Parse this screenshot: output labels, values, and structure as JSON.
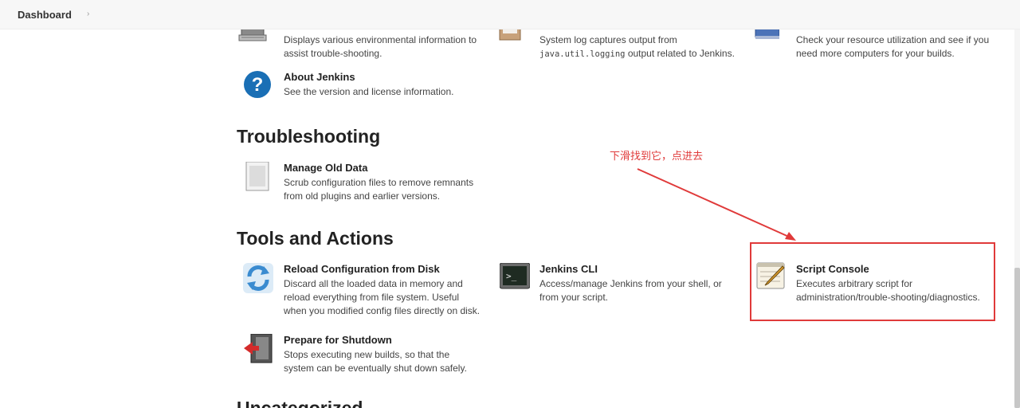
{
  "header": {
    "breadcrumb": "Dashboard",
    "separator": "›"
  },
  "items": {
    "system_info_desc": "Displays various environmental information to assist trouble-shooting.",
    "system_log_desc_a": "System log captures output from",
    "system_log_desc_code": "java.util.logging",
    "system_log_desc_b": "output related to Jenkins.",
    "load_stats_desc": "Check your resource utilization and see if you need more computers for your builds.",
    "about_title": "About Jenkins",
    "about_desc": "See the version and license information.",
    "manage_old_title": "Manage Old Data",
    "manage_old_desc": "Scrub configuration files to remove remnants from old plugins and earlier versions.",
    "reload_title": "Reload Configuration from Disk",
    "reload_desc": "Discard all the loaded data in memory and reload everything from file system. Useful when you modified config files directly on disk.",
    "cli_title": "Jenkins CLI",
    "cli_desc": "Access/manage Jenkins from your shell, or from your script.",
    "script_title": "Script Console",
    "script_desc": "Executes arbitrary script for administration/trouble-shooting/diagnostics.",
    "shutdown_title": "Prepare for Shutdown",
    "shutdown_desc": "Stops executing new builds, so that the system can be eventually shut down safely."
  },
  "sections": {
    "troubleshooting": "Troubleshooting",
    "tools": "Tools and Actions",
    "uncategorized": "Uncategorized"
  },
  "annotation": {
    "text": "下滑找到它，点进去",
    "color": "#e03a3a"
  },
  "colors": {
    "help_blue": "#1a6fb5",
    "arrow_red": "#e03a3a"
  },
  "icons": {
    "system_info": "computer-icon",
    "system_log": "clipboard-icon",
    "load_stats": "monitor-icon",
    "about": "help-icon",
    "manage_old": "document-icon",
    "reload": "refresh-icon",
    "cli": "terminal-icon",
    "script": "notepad-icon",
    "shutdown": "exit-door-icon"
  }
}
